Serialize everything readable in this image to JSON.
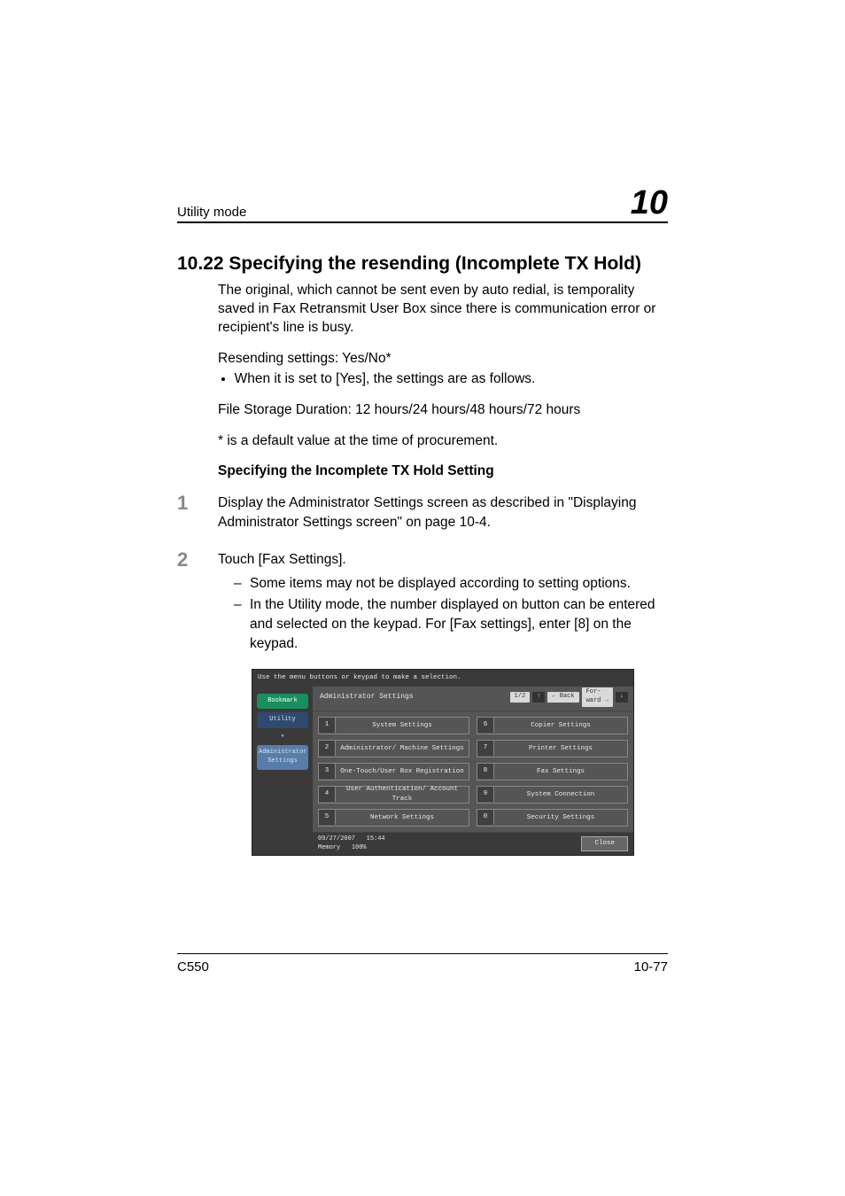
{
  "header": {
    "section_name": "Utility mode",
    "chapter_number": "10"
  },
  "section": {
    "title": "10.22 Specifying the resending (Incomplete TX Hold)",
    "intro": "The original, which cannot be sent even by auto redial, is temporality saved in Fax Retransmit User Box since there is communication error or recipient's line is busy.",
    "resending_line": "Resending settings: Yes/No*",
    "resending_note": "When it is set to [Yes], the settings are as follows.",
    "storage": "File Storage Duration: 12 hours/24 hours/48 hours/72 hours",
    "default_note": "* is a default value at the time of procurement.",
    "subheading": "Specifying the Incomplete TX Hold Setting",
    "steps": [
      {
        "num": "1",
        "text": "Display the Administrator Settings screen as described in \"Displaying Administrator Settings screen\" on page 10-4.",
        "subs": []
      },
      {
        "num": "2",
        "text": "Touch [Fax Settings].",
        "subs": [
          "Some items may not be displayed according to setting options.",
          "In the Utility mode, the number displayed on button can be entered and selected on the keypad. For [Fax settings], enter [8] on the keypad."
        ]
      }
    ]
  },
  "device_screen": {
    "hint": "Use the menu buttons or keypad to make a selection.",
    "sidebar": {
      "bookmark": "Bookmark",
      "utility": "Utility",
      "admin": "Administrator Settings"
    },
    "breadcrumb": "Administrator Settings",
    "pager": {
      "page": "1/2",
      "back": "← Back",
      "fwd1": "For-",
      "fwd2": "ward →"
    },
    "left_buttons": [
      {
        "n": "1",
        "l": "System Settings"
      },
      {
        "n": "2",
        "l": "Administrator/ Machine Settings"
      },
      {
        "n": "3",
        "l": "One-Touch/User Box Registration"
      },
      {
        "n": "4",
        "l": "User Authentication/ Account Track"
      },
      {
        "n": "5",
        "l": "Network Settings"
      }
    ],
    "right_buttons": [
      {
        "n": "6",
        "l": "Copier Settings"
      },
      {
        "n": "7",
        "l": "Printer Settings"
      },
      {
        "n": "8",
        "l": "Fax Settings"
      },
      {
        "n": "9",
        "l": "System Connection"
      },
      {
        "n": "0",
        "l": "Security Settings"
      }
    ],
    "status": {
      "date": "09/27/2007",
      "time": "15:44",
      "memory_label": "Memory",
      "memory_val": "100%",
      "close": "Close"
    }
  },
  "footer": {
    "model": "C550",
    "page_no": "10-77"
  }
}
